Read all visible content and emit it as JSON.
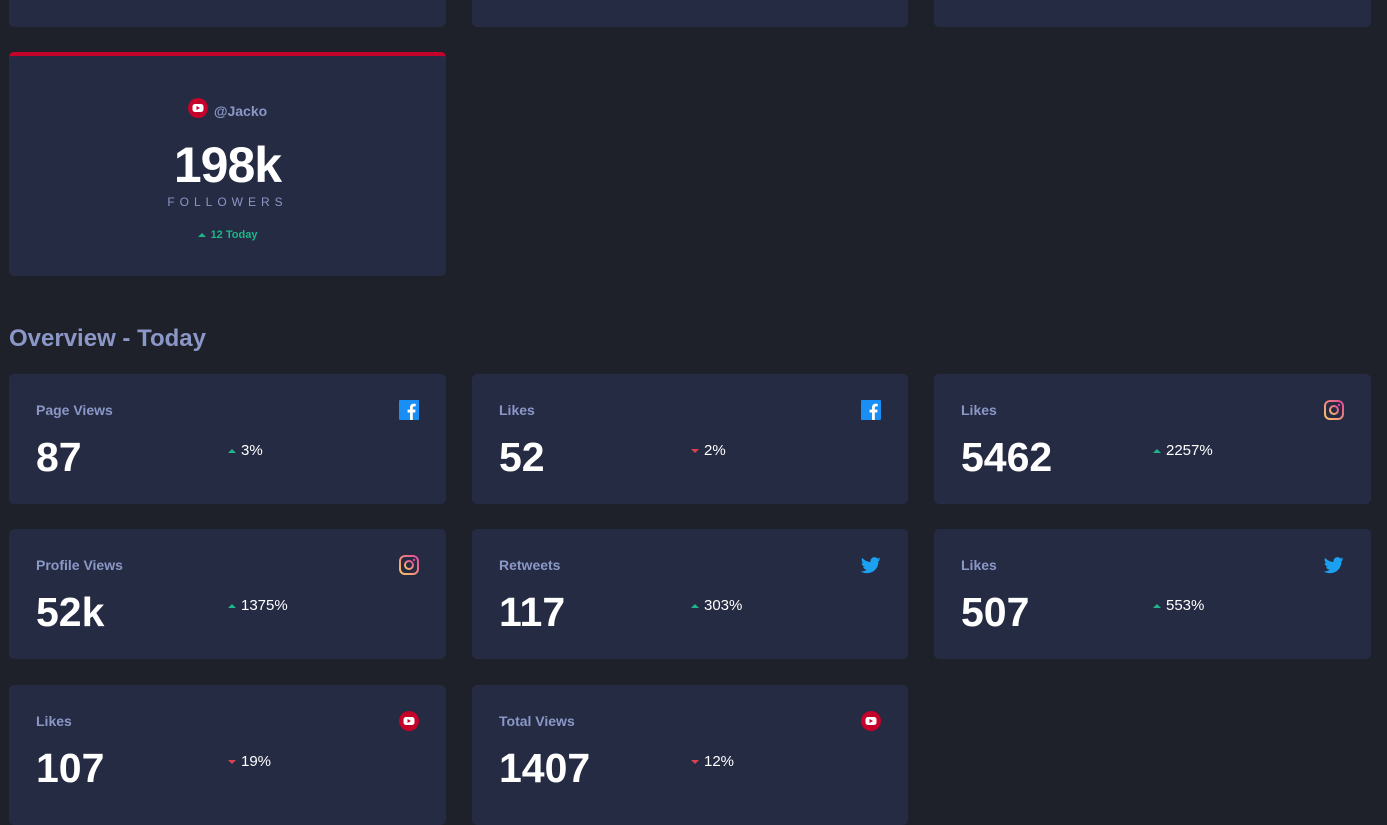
{
  "accent": {
    "youtube": "#c4032a",
    "facebook": "#198ff5",
    "twitter": "#1ca0f2",
    "instagram": "#f3a06b",
    "up": "#1eb589",
    "down": "#dc414c"
  },
  "follower_card": {
    "platform_icon": "youtube-icon",
    "handle": "@Jacko",
    "count": "198k",
    "label": "FOLLOWERS",
    "change": "12 Today",
    "direction": "up"
  },
  "overview": {
    "title": "Overview - Today",
    "cards": [
      {
        "label": "Page Views",
        "icon": "facebook-icon",
        "value": "87",
        "change": "3%",
        "direction": "up"
      },
      {
        "label": "Likes",
        "icon": "facebook-icon",
        "value": "52",
        "change": "2%",
        "direction": "down"
      },
      {
        "label": "Likes",
        "icon": "instagram-icon",
        "value": "5462",
        "change": "2257%",
        "direction": "up"
      },
      {
        "label": "Profile Views",
        "icon": "instagram-icon",
        "value": "52k",
        "change": "1375%",
        "direction": "up"
      },
      {
        "label": "Retweets",
        "icon": "twitter-icon",
        "value": "117",
        "change": "303%",
        "direction": "up"
      },
      {
        "label": "Likes",
        "icon": "twitter-icon",
        "value": "507",
        "change": "553%",
        "direction": "up"
      },
      {
        "label": "Likes",
        "icon": "youtube-icon",
        "value": "107",
        "change": "19%",
        "direction": "down"
      },
      {
        "label": "Total Views",
        "icon": "youtube-icon",
        "value": "1407",
        "change": "12%",
        "direction": "down"
      }
    ]
  }
}
